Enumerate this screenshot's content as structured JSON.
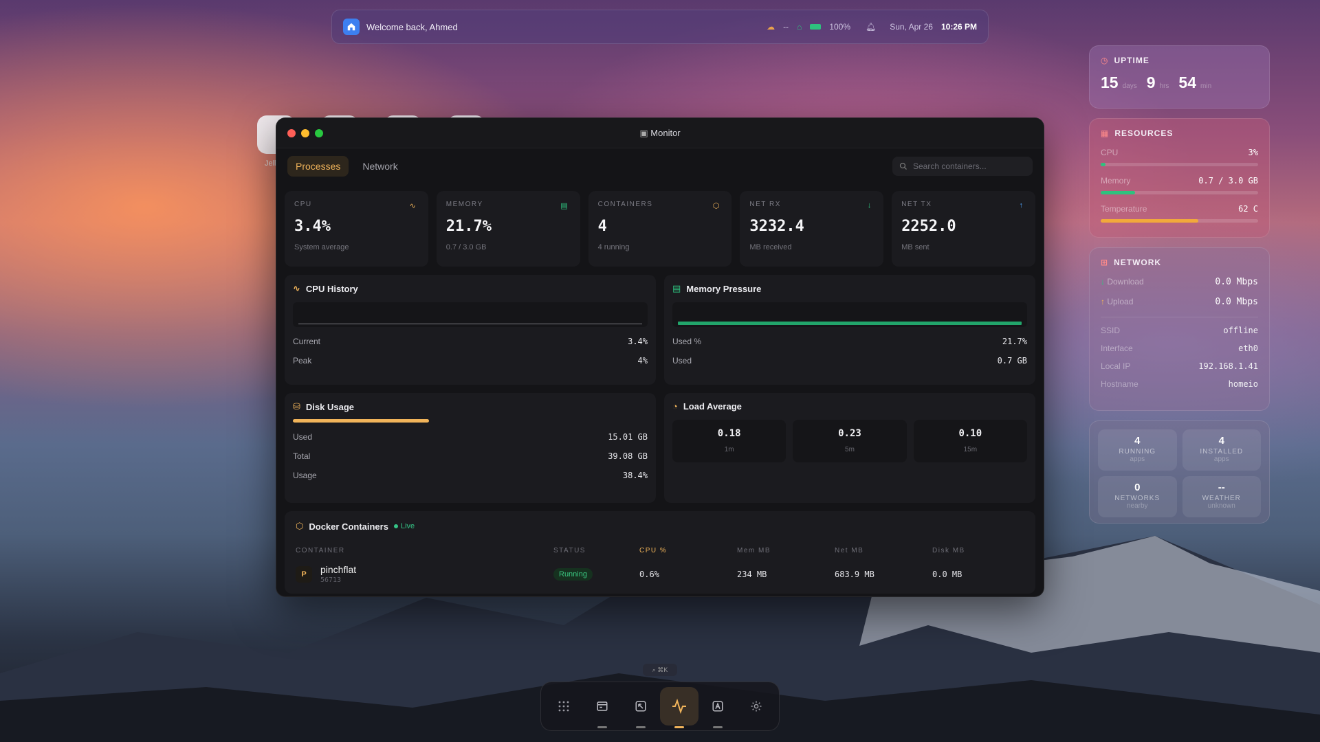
{
  "topbar": {
    "welcome": "Welcome back, Ahmed",
    "weather": "--",
    "battery": "100%",
    "date": "Sun, Apr 26",
    "time": "10:26 PM"
  },
  "desktop": {
    "partial_label": "Jell"
  },
  "window": {
    "title": "Monitor",
    "tabs": [
      {
        "label": "Processes",
        "active": true
      },
      {
        "label": "Network",
        "active": false
      }
    ],
    "search_placeholder": "Search containers..."
  },
  "stats": [
    {
      "label": "CPU",
      "value": "3.4%",
      "sub": "System average",
      "icon": "activity-icon"
    },
    {
      "label": "MEMORY",
      "value": "21.7%",
      "sub": "0.7 / 3.0 GB",
      "icon": "memory-icon"
    },
    {
      "label": "CONTAINERS",
      "value": "4",
      "sub": "4 running",
      "icon": "box-icon"
    },
    {
      "label": "NET RX",
      "value": "3232.4",
      "sub": "MB received",
      "icon": "arrow-down-icon"
    },
    {
      "label": "NET TX",
      "value": "2252.0",
      "sub": "MB sent",
      "icon": "arrow-up-icon"
    }
  ],
  "cpu_history": {
    "title": "CPU History",
    "rows": [
      {
        "label": "Current",
        "value": "3.4%"
      },
      {
        "label": "Peak",
        "value": "4%"
      }
    ]
  },
  "memory_pressure": {
    "title": "Memory Pressure",
    "rows": [
      {
        "label": "Used %",
        "value": "21.7%"
      },
      {
        "label": "Used",
        "value": "0.7 GB"
      }
    ]
  },
  "disk_usage": {
    "title": "Disk Usage",
    "fill_fraction": 0.384,
    "rows": [
      {
        "label": "Used",
        "value": "15.01 GB"
      },
      {
        "label": "Total",
        "value": "39.08 GB"
      },
      {
        "label": "Usage",
        "value": "38.4%"
      }
    ]
  },
  "load_average": {
    "title": "Load Average",
    "cells": [
      {
        "value": "0.18",
        "label": "1m"
      },
      {
        "value": "0.23",
        "label": "5m"
      },
      {
        "value": "0.10",
        "label": "15m"
      }
    ]
  },
  "docker": {
    "title": "Docker Containers",
    "live": "Live",
    "headers": [
      "CONTAINER",
      "STATUS",
      "CPU %",
      "Mem MB",
      "Net MB",
      "Disk MB"
    ],
    "rows": [
      {
        "initial": "P",
        "name": "pinchflat",
        "id": "56713",
        "status": "Running",
        "cpu": "0.6%",
        "mem": "234 MB",
        "net": "683.9 MB",
        "disk": "0.0 MB"
      }
    ]
  },
  "uptime": {
    "title": "UPTIME",
    "days": "15",
    "days_unit": "days",
    "hrs": "9",
    "hrs_unit": "hrs",
    "min": "54",
    "min_unit": "min"
  },
  "resources": {
    "title": "RESOURCES",
    "rows": [
      {
        "label": "CPU",
        "value": "3%",
        "fraction": 0.03,
        "color": "#2ec27e"
      },
      {
        "label": "Memory",
        "value": "0.7 / 3.0 GB",
        "fraction": 0.22,
        "color": "#2ec27e"
      },
      {
        "label": "Temperature",
        "value": "62 C",
        "fraction": 0.62,
        "color": "#f2a93b"
      }
    ]
  },
  "network_widget": {
    "title": "NETWORK",
    "download_label": "Download",
    "download": "0.0 Mbps",
    "upload_label": "Upload",
    "upload": "0.0 Mbps",
    "info": [
      {
        "label": "SSID",
        "value": "offline"
      },
      {
        "label": "Interface",
        "value": "eth0"
      },
      {
        "label": "Local IP",
        "value": "192.168.1.41"
      },
      {
        "label": "Hostname",
        "value": "homeio"
      }
    ]
  },
  "tiles": [
    {
      "num": "4",
      "label": "RUNNING",
      "sub": "apps"
    },
    {
      "num": "4",
      "label": "INSTALLED",
      "sub": "apps"
    },
    {
      "num": "0",
      "label": "NETWORKS",
      "sub": "nearby"
    },
    {
      "num": "--",
      "label": "WEATHER",
      "sub": "unknown"
    }
  ],
  "dock": {
    "hint": "⌘K"
  },
  "colors": {
    "accent": "#f1b45a",
    "green": "#2ec27e",
    "window_bg": "#141417"
  }
}
